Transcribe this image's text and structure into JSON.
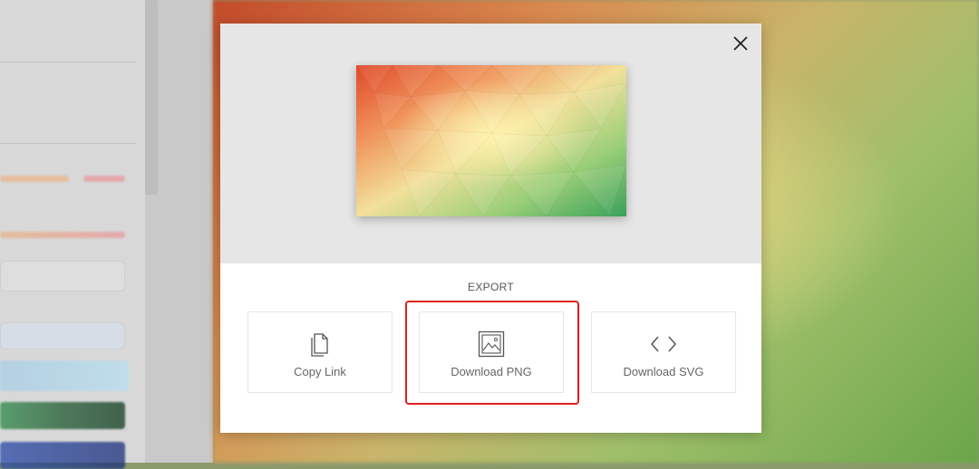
{
  "modal": {
    "close_icon": "close-icon",
    "export_title": "EXPORT",
    "options": [
      {
        "label": "Copy Link",
        "icon": "copy-icon"
      },
      {
        "label": "Download PNG",
        "icon": "image-icon"
      },
      {
        "label": "Download SVG",
        "icon": "code-icon"
      }
    ],
    "highlight_color": "#e02020"
  }
}
